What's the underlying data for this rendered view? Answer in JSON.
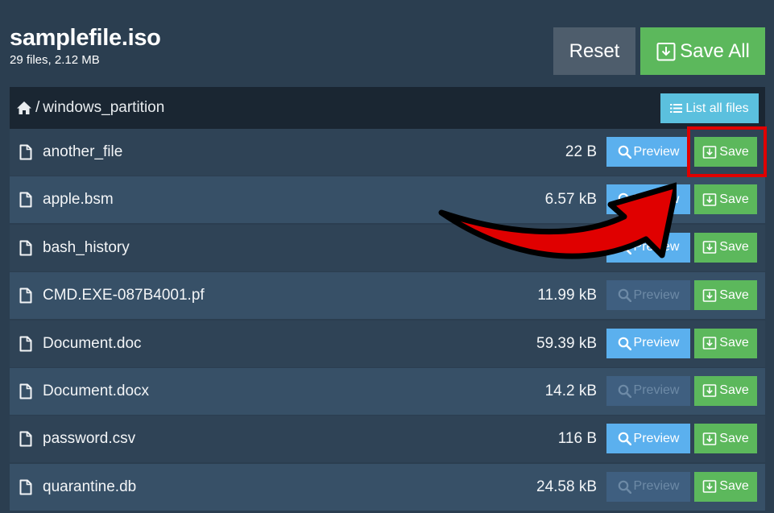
{
  "header": {
    "title": "samplefile.iso",
    "subtitle": "29 files, 2.12 MB"
  },
  "toolbar": {
    "reset_label": "Reset",
    "save_all_label": "Save All"
  },
  "breadcrumb": {
    "separator": "/",
    "path": "windows_partition",
    "list_all_label": "List all files"
  },
  "labels": {
    "preview": "Preview",
    "save": "Save"
  },
  "files": [
    {
      "name": "another_file",
      "size": "22 B",
      "preview_enabled": true
    },
    {
      "name": "apple.bsm",
      "size": "6.57 kB",
      "preview_enabled": true
    },
    {
      "name": "bash_history",
      "size": "",
      "preview_enabled": true
    },
    {
      "name": "CMD.EXE-087B4001.pf",
      "size": "11.99 kB",
      "preview_enabled": false
    },
    {
      "name": "Document.doc",
      "size": "59.39 kB",
      "preview_enabled": true
    },
    {
      "name": "Document.docx",
      "size": "14.2 kB",
      "preview_enabled": false
    },
    {
      "name": "password.csv",
      "size": "116 B",
      "preview_enabled": true
    },
    {
      "name": "quarantine.db",
      "size": "24.58 kB",
      "preview_enabled": false
    }
  ],
  "colors": {
    "background": "#2b3e50",
    "save": "#5cb85c",
    "preview": "#5bb0ee",
    "list_all": "#5bc0de",
    "annotation": "#e00000"
  },
  "icons": {
    "home": "home-icon",
    "list": "list-icon",
    "file": "file-icon",
    "search": "search-icon",
    "download": "download-icon"
  }
}
